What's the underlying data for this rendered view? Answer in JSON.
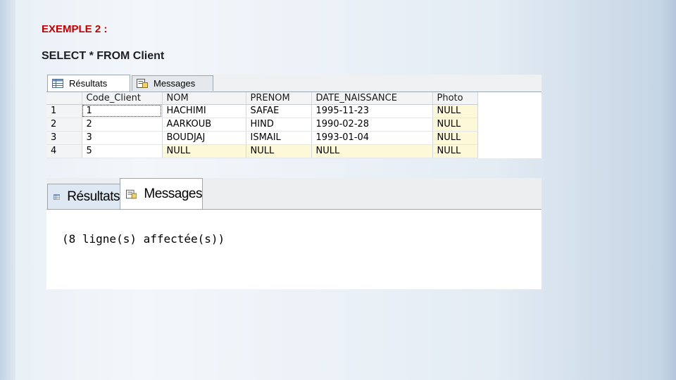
{
  "slide": {
    "title": "EXEMPLE 2 :",
    "query": "SELECT * FROM Client"
  },
  "results_panel": {
    "tabs": [
      {
        "label": "Résultats",
        "icon": "grid-icon",
        "active": true
      },
      {
        "label": "Messages",
        "icon": "messages-icon",
        "active": false
      }
    ],
    "columns": [
      "",
      "Code_Client",
      "NOM",
      "PRENOM",
      "DATE_NAISSANCE",
      "Photo"
    ],
    "rows": [
      [
        "1",
        "1",
        "HACHIMI",
        "SAFAE",
        "1995-11-23",
        "NULL"
      ],
      [
        "2",
        "2",
        "AARKOUB",
        "HIND",
        "1990-02-28",
        "NULL"
      ],
      [
        "3",
        "3",
        "BOUDJAJ",
        "ISMAIL",
        "1993-01-04",
        "NULL"
      ],
      [
        "4",
        "5",
        "NULL",
        "NULL",
        "NULL",
        "NULL"
      ]
    ]
  },
  "messages_panel": {
    "tabs": [
      {
        "label": "Résultats",
        "icon": "grid-icon",
        "active": false
      },
      {
        "label": "Messages",
        "icon": "messages-icon",
        "active": true
      }
    ],
    "message": "(8 ligne(s) affectée(s))"
  },
  "colors": {
    "title": "#c00000",
    "null_cell": "#fdf9d8"
  }
}
